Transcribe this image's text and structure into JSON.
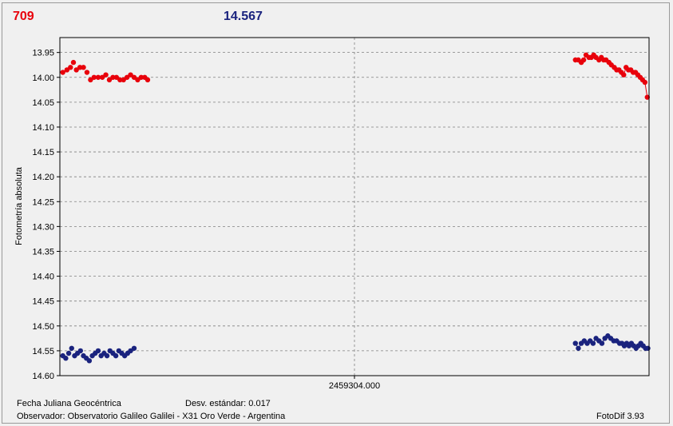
{
  "header": {
    "left_value": "709",
    "right_value": "14.567"
  },
  "colors": {
    "series_a": "#e8000b",
    "series_b": "#1a237e",
    "grid": "#808080"
  },
  "footer": {
    "jd_label": "Fecha Juliana Geocéntrica",
    "stddev_label": "Desv. estándar: 0.017",
    "observer": "Observador: Observatorio Galileo Galilei - X31 Oro Verde - Argentina",
    "version": "FotoDif 3.93"
  },
  "chart_data": {
    "type": "scatter",
    "ylabel": "Fotometría absoluta",
    "xlabel": "",
    "x_center_label": "2459304.000",
    "ylim": [
      13.92,
      14.6
    ],
    "y_inverted": true,
    "xlim": [
      0,
      100
    ],
    "yticks": [
      "13.95",
      "14.00",
      "14.05",
      "14.10",
      "14.15",
      "14.20",
      "14.25",
      "14.30",
      "14.35",
      "14.40",
      "14.45",
      "14.50",
      "14.55",
      "14.60"
    ],
    "grid": true,
    "series": [
      {
        "color": "#e8000b",
        "connect_from_index": 25,
        "points": [
          [
            0.5,
            13.99
          ],
          [
            1.2,
            13.985
          ],
          [
            1.8,
            13.98
          ],
          [
            2.3,
            13.97
          ],
          [
            2.8,
            13.985
          ],
          [
            3.4,
            13.98
          ],
          [
            4.0,
            13.98
          ],
          [
            4.6,
            13.99
          ],
          [
            5.2,
            14.005
          ],
          [
            5.8,
            14.0
          ],
          [
            6.5,
            14.0
          ],
          [
            7.2,
            14.0
          ],
          [
            7.8,
            13.995
          ],
          [
            8.4,
            14.005
          ],
          [
            9.0,
            14.0
          ],
          [
            9.6,
            14.0
          ],
          [
            10.2,
            14.005
          ],
          [
            10.8,
            14.005
          ],
          [
            11.4,
            14.0
          ],
          [
            12.0,
            13.995
          ],
          [
            12.6,
            14.0
          ],
          [
            13.2,
            14.005
          ],
          [
            13.8,
            14.0
          ],
          [
            14.4,
            14.0
          ],
          [
            14.9,
            14.005
          ],
          [
            87.5,
            13.965
          ],
          [
            88.0,
            13.965
          ],
          [
            88.5,
            13.97
          ],
          [
            88.9,
            13.965
          ],
          [
            89.3,
            13.955
          ],
          [
            89.8,
            13.96
          ],
          [
            90.2,
            13.96
          ],
          [
            90.6,
            13.955
          ],
          [
            91.0,
            13.96
          ],
          [
            91.5,
            13.965
          ],
          [
            91.9,
            13.96
          ],
          [
            92.3,
            13.965
          ],
          [
            92.7,
            13.965
          ],
          [
            93.2,
            13.97
          ],
          [
            93.6,
            13.975
          ],
          [
            94.1,
            13.98
          ],
          [
            94.5,
            13.985
          ],
          [
            94.9,
            13.985
          ],
          [
            95.3,
            13.99
          ],
          [
            95.7,
            13.995
          ],
          [
            96.1,
            13.98
          ],
          [
            96.5,
            13.985
          ],
          [
            96.9,
            13.985
          ],
          [
            97.3,
            13.99
          ],
          [
            97.7,
            13.99
          ],
          [
            98.1,
            13.995
          ],
          [
            98.5,
            14.0
          ],
          [
            98.9,
            14.005
          ],
          [
            99.3,
            14.01
          ],
          [
            99.7,
            14.04
          ]
        ]
      },
      {
        "color": "#1a237e",
        "connect_from_index": 25,
        "points": [
          [
            0.5,
            14.56
          ],
          [
            1.0,
            14.565
          ],
          [
            1.5,
            14.555
          ],
          [
            2.0,
            14.545
          ],
          [
            2.5,
            14.56
          ],
          [
            3.0,
            14.555
          ],
          [
            3.5,
            14.55
          ],
          [
            4.0,
            14.56
          ],
          [
            4.5,
            14.565
          ],
          [
            5.0,
            14.57
          ],
          [
            5.5,
            14.56
          ],
          [
            6.0,
            14.555
          ],
          [
            6.5,
            14.55
          ],
          [
            7.0,
            14.56
          ],
          [
            7.5,
            14.555
          ],
          [
            8.0,
            14.56
          ],
          [
            8.5,
            14.55
          ],
          [
            9.0,
            14.555
          ],
          [
            9.5,
            14.56
          ],
          [
            10.0,
            14.55
          ],
          [
            10.5,
            14.555
          ],
          [
            11.0,
            14.56
          ],
          [
            11.5,
            14.555
          ],
          [
            12.0,
            14.55
          ],
          [
            12.6,
            14.545
          ],
          [
            87.5,
            14.535
          ],
          [
            88.0,
            14.545
          ],
          [
            88.5,
            14.535
          ],
          [
            89.0,
            14.53
          ],
          [
            89.5,
            14.535
          ],
          [
            90.0,
            14.53
          ],
          [
            90.5,
            14.535
          ],
          [
            91.0,
            14.525
          ],
          [
            91.5,
            14.53
          ],
          [
            92.0,
            14.535
          ],
          [
            92.5,
            14.525
          ],
          [
            93.0,
            14.52
          ],
          [
            93.5,
            14.525
          ],
          [
            94.0,
            14.53
          ],
          [
            94.5,
            14.53
          ],
          [
            95.0,
            14.535
          ],
          [
            95.4,
            14.535
          ],
          [
            95.8,
            14.54
          ],
          [
            96.2,
            14.535
          ],
          [
            96.6,
            14.54
          ],
          [
            97.0,
            14.535
          ],
          [
            97.4,
            14.54
          ],
          [
            97.8,
            14.545
          ],
          [
            98.2,
            14.54
          ],
          [
            98.6,
            14.535
          ],
          [
            99.0,
            14.54
          ],
          [
            99.4,
            14.545
          ],
          [
            99.8,
            14.545
          ]
        ]
      }
    ]
  }
}
